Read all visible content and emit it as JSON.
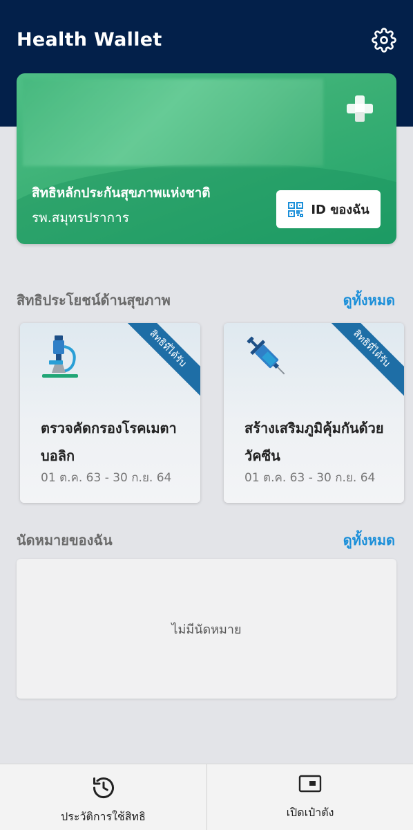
{
  "app": {
    "title": "Health Wallet"
  },
  "header": {
    "settings_icon": "gear-icon"
  },
  "card": {
    "title": "สิทธิหลักประกันสุขภาพแห่งชาติ",
    "hospital": "รพ.สมุทรปราการ",
    "my_id_label": "ID ของฉัน",
    "plus_icon": "plus-icon",
    "qr_icon": "qr-code-icon"
  },
  "benefits": {
    "section_title": "สิทธิประโยชน์ด้านสุขภาพ",
    "see_all": "ดูทั้งหมด",
    "items": [
      {
        "ribbon": "สิทธิที่ได้รับ",
        "icon": "microscope-icon",
        "title": "ตรวจคัดกรองโรคเมตาบอลิก",
        "dates": "01 ต.ค. 63 - 30 ก.ย. 64"
      },
      {
        "ribbon": "สิทธิที่ได้รับ",
        "icon": "syringe-icon",
        "title": "สร้างเสริมภูมิคุ้มกันด้วยวัคซีน",
        "dates": "01 ต.ค. 63 - 30 ก.ย. 64"
      }
    ]
  },
  "appointments": {
    "section_title": "นัดหมายของฉัน",
    "see_all": "ดูทั้งหมด",
    "empty_text": "ไม่มีนัดหมาย"
  },
  "bottom_nav": {
    "items": [
      {
        "label": "ประวัติการใช้สิทธิ",
        "icon": "history-icon"
      },
      {
        "label": "เปิดเป๋าตัง",
        "icon": "wallet-icon"
      }
    ]
  },
  "colors": {
    "header": "#03204a",
    "card_green": "#3bb075",
    "link_blue": "#1b8fd9",
    "ribbon_blue": "#1e6ea6"
  }
}
